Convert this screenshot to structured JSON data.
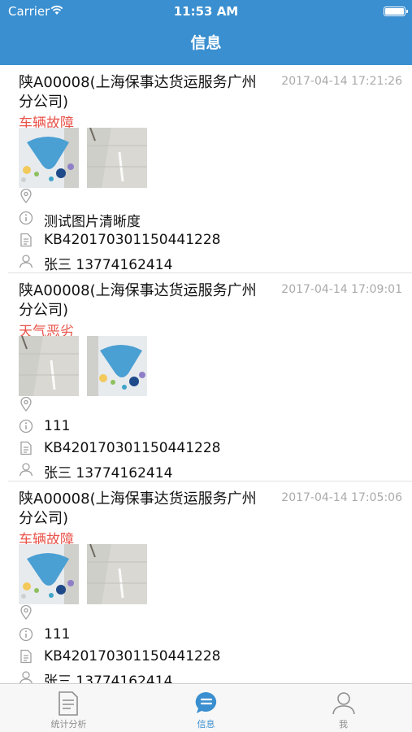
{
  "status_bar": {
    "carrier": "Carrier",
    "time": "11:53 AM"
  },
  "nav": {
    "title": "信息"
  },
  "colors": {
    "accent": "#3a8fd0",
    "reason": "#e8544a",
    "time": "#aaaaaa"
  },
  "cards": [
    {
      "plate": "陕A00008(上海保事达货运服务广州分公司)",
      "time": "2017-04-14 17:21:26",
      "reason": "车辆故障",
      "photos": [
        "poster-photo",
        "floor-photo"
      ],
      "location": "",
      "description": "测试图片清晰度",
      "order_no": "KB420170301150441228",
      "contact": "张三 13774162414"
    },
    {
      "plate": "陕A00008(上海保事达货运服务广州分公司)",
      "time": "2017-04-14 17:09:01",
      "reason": "天气恶劣",
      "photos": [
        "floor-photo",
        "poster-photo"
      ],
      "location": "",
      "description": "111",
      "order_no": "KB420170301150441228",
      "contact": "张三 13774162414"
    },
    {
      "plate": "陕A00008(上海保事达货运服务广州分公司)",
      "time": "2017-04-14 17:05:06",
      "reason": "车辆故障",
      "photos": [
        "poster-photo",
        "floor-photo"
      ],
      "location": "",
      "description": "111",
      "order_no": "KB420170301150441228",
      "contact": "张三 13774162414"
    }
  ],
  "tabs": [
    {
      "label": "统计分析",
      "icon": "document-icon",
      "active": false
    },
    {
      "label": "信息",
      "icon": "chat-bubble-icon",
      "active": true
    },
    {
      "label": "我",
      "icon": "person-icon",
      "active": false
    }
  ]
}
